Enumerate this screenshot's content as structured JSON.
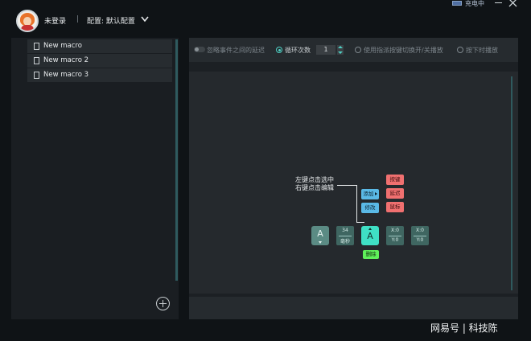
{
  "header": {
    "login_status": "未登录",
    "separator": "|",
    "config_label": "配置: 默认配置",
    "battery_status": "充电中"
  },
  "macros": [
    {
      "label": "New macro"
    },
    {
      "label": "New macro 2"
    },
    {
      "label": "New macro 3"
    }
  ],
  "options": {
    "ignore_delay": "忽略事件之间的延迟",
    "loop_count_label": "循环次数",
    "loop_count_value": "1",
    "toggle_mode": "使用指派按键切换开/关播放",
    "hold_mode": "按下时播放",
    "selected": "loop"
  },
  "editor": {
    "hint_line1": "左键点击选中",
    "hint_line2": "右键点击编辑",
    "key1": "A",
    "delay_value": "34",
    "delay_unit": "毫秒",
    "key2": "A",
    "pos1_x": "X:0",
    "pos1_y": "Y:0",
    "pos2_x": "X:0",
    "pos2_y": "Y:0",
    "menu_add": "添加",
    "menu_edit": "修改",
    "menu_key": "按键",
    "menu_delay": "延迟",
    "menu_mouse": "鼠标",
    "menu_delete": "删除"
  },
  "watermark": "网易号 | 科技陈",
  "colors": {
    "accent": "#3fe0c5",
    "add_blue": "#5ab9e6",
    "menu_red": "#f07070",
    "delete_green": "#5ff05a"
  }
}
